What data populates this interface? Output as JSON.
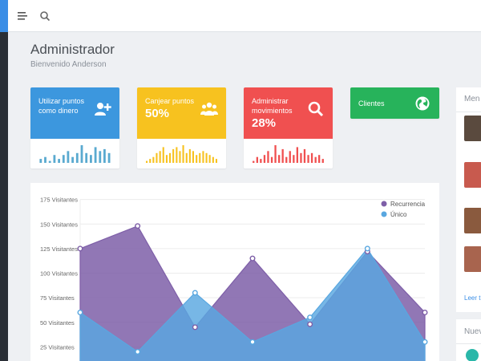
{
  "header": {
    "title": "Administrador",
    "subtitle": "Bienvenido Anderson"
  },
  "cards": [
    {
      "label": "Utilizar puntos como dinero",
      "value": "",
      "icon": "add-user-icon",
      "color": "#3c97de",
      "spark_color": "#5aaad0",
      "spark": [
        2,
        3,
        1,
        4,
        2,
        4,
        6,
        3,
        5,
        9,
        5,
        4,
        8,
        6,
        7,
        5
      ]
    },
    {
      "label": "Canjear puntos",
      "value": "50%",
      "icon": "users-group-icon",
      "color": "#f7c21f",
      "spark_color": "#f7c21f",
      "spark": [
        1,
        2,
        3,
        5,
        6,
        8,
        4,
        5,
        7,
        8,
        6,
        9,
        5,
        7,
        6,
        4,
        5,
        6,
        5,
        4,
        3,
        2
      ]
    },
    {
      "label": "Administrar movimientos",
      "value": "28%",
      "icon": "search-icon",
      "color": "#f05050",
      "spark_color": "#f05050",
      "spark": [
        1,
        3,
        2,
        4,
        6,
        3,
        9,
        4,
        7,
        3,
        6,
        4,
        8,
        5,
        7,
        4,
        5,
        3,
        4,
        2
      ]
    },
    {
      "label": "Clientes",
      "value": "",
      "icon": "globe-icon",
      "color": "#27b35b"
    }
  ],
  "chart_data": {
    "type": "area",
    "x": [
      0,
      1,
      2,
      3,
      4,
      5,
      6
    ],
    "ylabel": "",
    "ytick_labels": [
      "25 Visitantes",
      "50 Visitantes",
      "75 Visitantes",
      "100 Visitantes",
      "125 Visitantes",
      "150 Visitantes",
      "175 Visitantes"
    ],
    "yticks": [
      25,
      50,
      75,
      100,
      125,
      150,
      175
    ],
    "ylim": [
      0,
      175
    ],
    "series": [
      {
        "name": "Recurrencia",
        "color": "#7e5fa8",
        "values": [
          125,
          148,
          45,
          115,
          48,
          122,
          60
        ]
      },
      {
        "name": "Único",
        "color": "#59a7e0",
        "values": [
          60,
          20,
          80,
          30,
          55,
          125,
          30
        ]
      }
    ],
    "legend_position": "top-right",
    "grid": true
  },
  "side": {
    "title": "Men",
    "link": "Leer t",
    "avatar_colors": [
      "#5a4a3e",
      "#c85a4e",
      "#8a5a3e",
      "#a8644e"
    ]
  },
  "side2": {
    "title": "Nuev"
  }
}
